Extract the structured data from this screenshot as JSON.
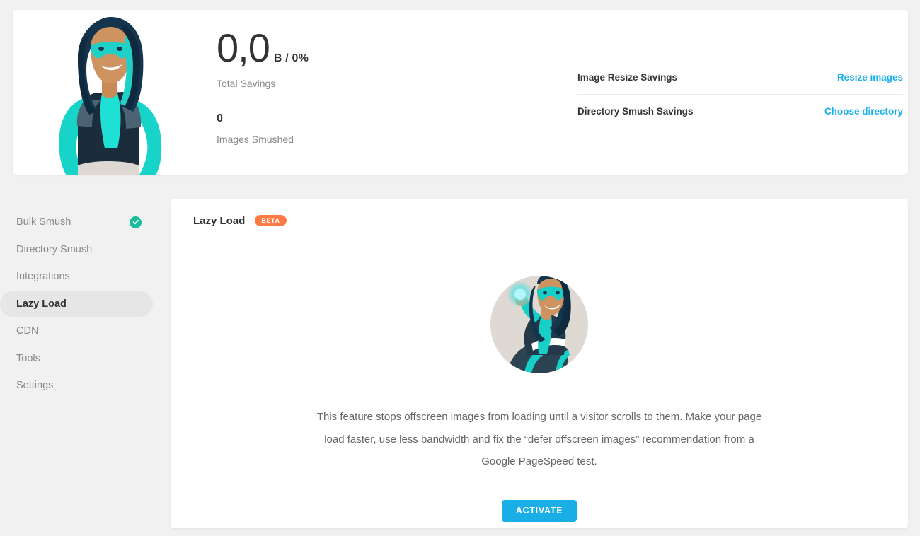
{
  "summary": {
    "total_value": "0,0",
    "total_unit": "B / 0%",
    "total_label": "Total Savings",
    "images_value": "0",
    "images_label": "Images Smushed",
    "mascot_icon": "superhero-mascot-illustration",
    "savings_rows": [
      {
        "name": "Image Resize Savings",
        "action": "Resize images"
      },
      {
        "name": "Directory Smush Savings",
        "action": "Choose directory"
      }
    ]
  },
  "sidebar": {
    "items": [
      {
        "label": "Bulk Smush",
        "active": false,
        "badge": "check-icon"
      },
      {
        "label": "Directory Smush",
        "active": false,
        "badge": ""
      },
      {
        "label": "Integrations",
        "active": false,
        "badge": ""
      },
      {
        "label": "Lazy Load",
        "active": true,
        "badge": ""
      },
      {
        "label": "CDN",
        "active": false,
        "badge": ""
      },
      {
        "label": "Tools",
        "active": false,
        "badge": ""
      },
      {
        "label": "Settings",
        "active": false,
        "badge": ""
      }
    ]
  },
  "content": {
    "title": "Lazy Load",
    "badge": "BETA",
    "hero_icon": "superhero-energy-orb-illustration",
    "description": "This feature stops offscreen images from loading until a visitor scrolls to them. Make your page load faster, use less bandwidth and fix the “defer offscreen images” recommendation from a Google PageSpeed test.",
    "activate_label": "ACTIVATE"
  },
  "colors": {
    "link": "#19b0ec",
    "accent_button": "#19aee5",
    "beta_badge": "#ff7a45",
    "check_badge": "#1abc9c",
    "page_background": "#f1f1f1"
  }
}
